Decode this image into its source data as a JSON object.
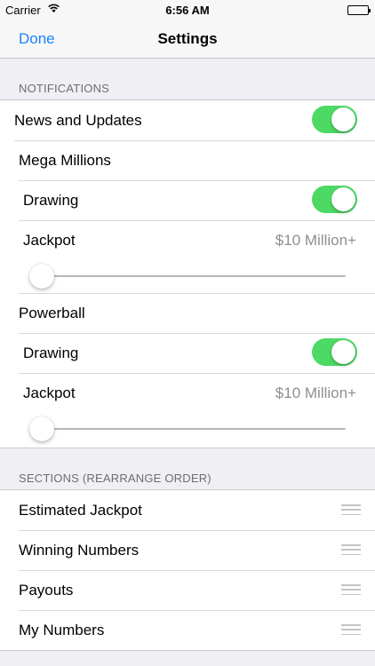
{
  "status_bar": {
    "carrier": "Carrier",
    "wifi_icon": "wifi-icon",
    "time": "6:56 AM",
    "battery_icon": "battery-icon"
  },
  "nav": {
    "done_label": "Done",
    "title": "Settings"
  },
  "notifications": {
    "header": "NOTIFICATIONS",
    "news": {
      "label": "News and Updates",
      "on": true
    },
    "mega_millions": {
      "label": "Mega Millions",
      "drawing": {
        "label": "Drawing",
        "on": true
      },
      "jackpot": {
        "label": "Jackpot",
        "value": "$10 Million+",
        "slider_level": 0.0
      }
    },
    "powerball": {
      "label": "Powerball",
      "drawing": {
        "label": "Drawing",
        "on": true
      },
      "jackpot": {
        "label": "Jackpot",
        "value": "$10 Million+",
        "slider_level": 0.0
      }
    }
  },
  "sections": {
    "header": "SECTIONS (REARRANGE ORDER)",
    "items": [
      {
        "label": "Estimated Jackpot"
      },
      {
        "label": "Winning Numbers"
      },
      {
        "label": "Payouts"
      },
      {
        "label": "My Numbers"
      }
    ],
    "reorder_icon": "reorder-handle-icon"
  },
  "colors": {
    "accent": "#1a82fb",
    "toggle_on": "#4cd964",
    "background": "#efeff4",
    "secondary_text": "#8e8e93"
  }
}
